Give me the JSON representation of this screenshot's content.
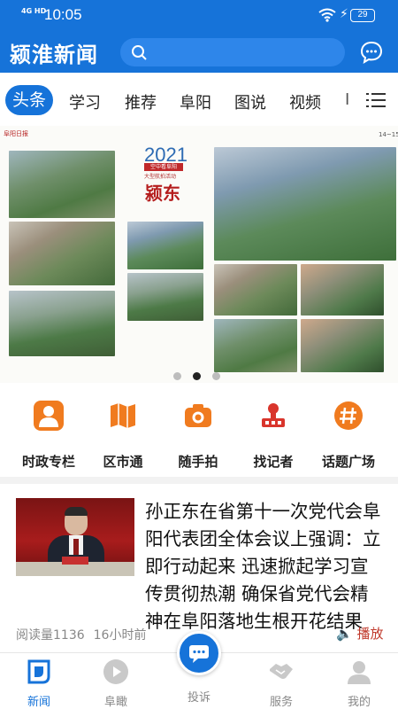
{
  "status_bar": {
    "signal": "4G HD",
    "time": "10:05",
    "battery": "29"
  },
  "header": {
    "app_title": "颍淮新闻"
  },
  "tabs": [
    "头条",
    "学习",
    "推荐",
    "阜阳",
    "图说",
    "视频",
    "I"
  ],
  "banner": {
    "masthead": "阜阳日报",
    "page_number": "14~15",
    "year": "2021",
    "subtitle": "空中看阜阳",
    "caption": "大型航拍活动",
    "headline": "颍东"
  },
  "shortcuts": [
    {
      "label": "时政专栏",
      "icon": "person-icon"
    },
    {
      "label": "区市通",
      "icon": "map-icon"
    },
    {
      "label": "随手拍",
      "icon": "camera-icon"
    },
    {
      "label": "找记者",
      "icon": "reporter-icon"
    },
    {
      "label": "话题广场",
      "icon": "hashtag-icon"
    }
  ],
  "news": {
    "title": "孙正东在省第十一次党代会阜阳代表团全体会议上强调：立即行动起来 迅速掀起学习宣传贯彻热潮 确保省党代会精神在阜阳落地生根开花结果",
    "reads": "阅读量1136",
    "time_ago": "16小时前",
    "play_label": "播放"
  },
  "bottom_nav": [
    {
      "label": "新闻",
      "icon": "news-icon"
    },
    {
      "label": "阜瞰",
      "icon": "play-icon"
    },
    {
      "label": "投诉",
      "icon": "chat-icon"
    },
    {
      "label": "服务",
      "icon": "handshake-icon"
    },
    {
      "label": "我的",
      "icon": "user-icon"
    }
  ],
  "colors": {
    "brand_blue": "#1673d9",
    "accent_orange": "#f07b1f",
    "accent_red": "#c0392b"
  }
}
